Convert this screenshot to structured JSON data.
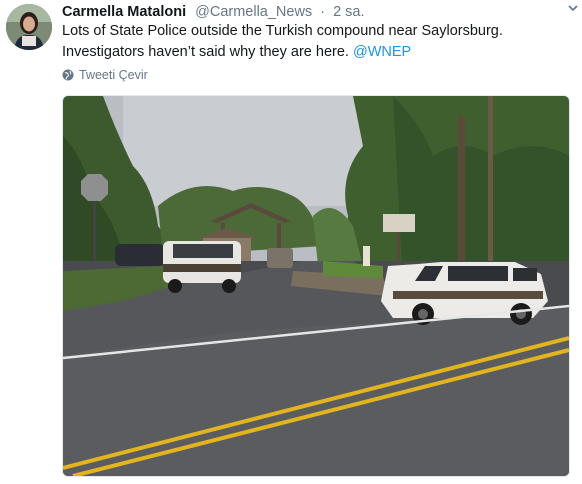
{
  "author": {
    "name": "Carmella Mataloni",
    "handle": "@Carmella_News",
    "separator": "·",
    "time": "2 sa."
  },
  "tweet": {
    "text": "Lots of State Police outside the Turkish compound near Saylorsburg. Investigators haven’t said why they are here.",
    "mention": "@WNEP"
  },
  "translate": {
    "label": "Tweeti Çevir",
    "icon": "globe-icon"
  },
  "menu": {
    "icon": "chevron-down-icon"
  },
  "colors": {
    "link": "#1b95e0",
    "muted": "#657786",
    "text": "#14171a"
  }
}
